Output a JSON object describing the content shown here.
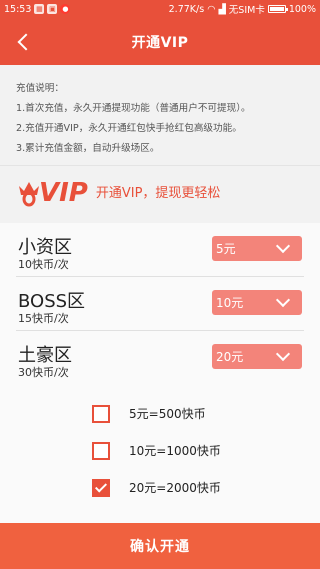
{
  "statusbar": {
    "time": "15:53",
    "net_speed": "2.77K/s",
    "carrier": "无SIM卡",
    "battery": "100%",
    "colors": {
      "bar": "#e8503a"
    }
  },
  "navbar": {
    "title": "开通VIP",
    "back_icon": "chevron-left-icon"
  },
  "notes": {
    "heading": "充值说明：",
    "lines": [
      "1.首次充值，永久开通提现功能（普通用户不可提现）。",
      "2.充值开通VIP，永久开通红包快手抢红包高级功能。",
      "3.累计充值金额，自动升级场区。"
    ]
  },
  "vip_banner": {
    "logo_text": "VIP",
    "slogan": "开通VIP，提现更轻松"
  },
  "plans": [
    {
      "name": "小资区",
      "price": "10快币/次",
      "selected": "5元"
    },
    {
      "name": "BOSS区",
      "price": "15快币/次",
      "selected": "10元"
    },
    {
      "name": "土豪区",
      "price": "30快币/次",
      "selected": "20元"
    }
  ],
  "options": [
    {
      "label": "5元=500快币",
      "checked": false
    },
    {
      "label": "10元=1000快币",
      "checked": false
    },
    {
      "label": "20元=2000快币",
      "checked": true
    }
  ],
  "confirm_button": {
    "label": "确认开通"
  },
  "theme": {
    "accent": "#e8503a",
    "select_bg": "#f3847a",
    "button": "#f0613f"
  }
}
